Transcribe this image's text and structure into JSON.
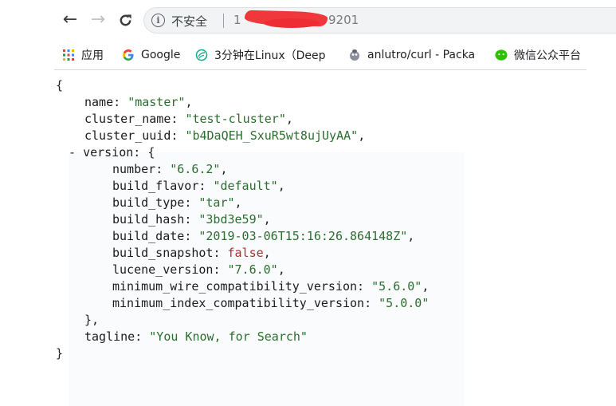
{
  "toolbar": {
    "back_icon": "←",
    "forward_icon": "→",
    "reload_icon": "C",
    "info_icon": "i",
    "security_label": "不安全",
    "url_prefix": "1",
    "url_suffix": "9201"
  },
  "bookmarks": [
    {
      "label": "应用",
      "icon": "apps-grid-icon"
    },
    {
      "label": "Google",
      "icon": "google-icon"
    },
    {
      "label": "3分钟在Linux（Deep",
      "icon": "deepin-icon"
    },
    {
      "label": "anlutro/curl - Packa",
      "icon": "docker-icon"
    },
    {
      "label": "微信公众平台",
      "icon": "wechat-icon"
    }
  ],
  "json": {
    "open_brace": "{",
    "close_brace": "}",
    "name_key": "name",
    "name_value": "\"master\"",
    "cluster_name_key": "cluster_name",
    "cluster_name_value": "\"test-cluster\"",
    "cluster_uuid_key": "cluster_uuid",
    "cluster_uuid_value": "\"b4DaQEH_SxuR5wt8ujUyAA\"",
    "version_toggle": "-",
    "version_key": "version",
    "version": {
      "number_key": "number",
      "number_value": "\"6.6.2\"",
      "build_flavor_key": "build_flavor",
      "build_flavor_value": "\"default\"",
      "build_type_key": "build_type",
      "build_type_value": "\"tar\"",
      "build_hash_key": "build_hash",
      "build_hash_value": "\"3bd3e59\"",
      "build_date_key": "build_date",
      "build_date_value": "\"2019-03-06T15:16:26.864148Z\"",
      "build_snapshot_key": "build_snapshot",
      "build_snapshot_value": "false",
      "lucene_version_key": "lucene_version",
      "lucene_version_value": "\"7.6.0\"",
      "minimum_wire_key": "minimum_wire_compatibility_version",
      "minimum_wire_value": "\"5.6.0\"",
      "minimum_index_key": "minimum_index_compatibility_version",
      "minimum_index_value": "\"5.0.0\""
    },
    "version_close": "},",
    "tagline_key": "tagline",
    "tagline_value": "\"You Know, for Search\""
  }
}
